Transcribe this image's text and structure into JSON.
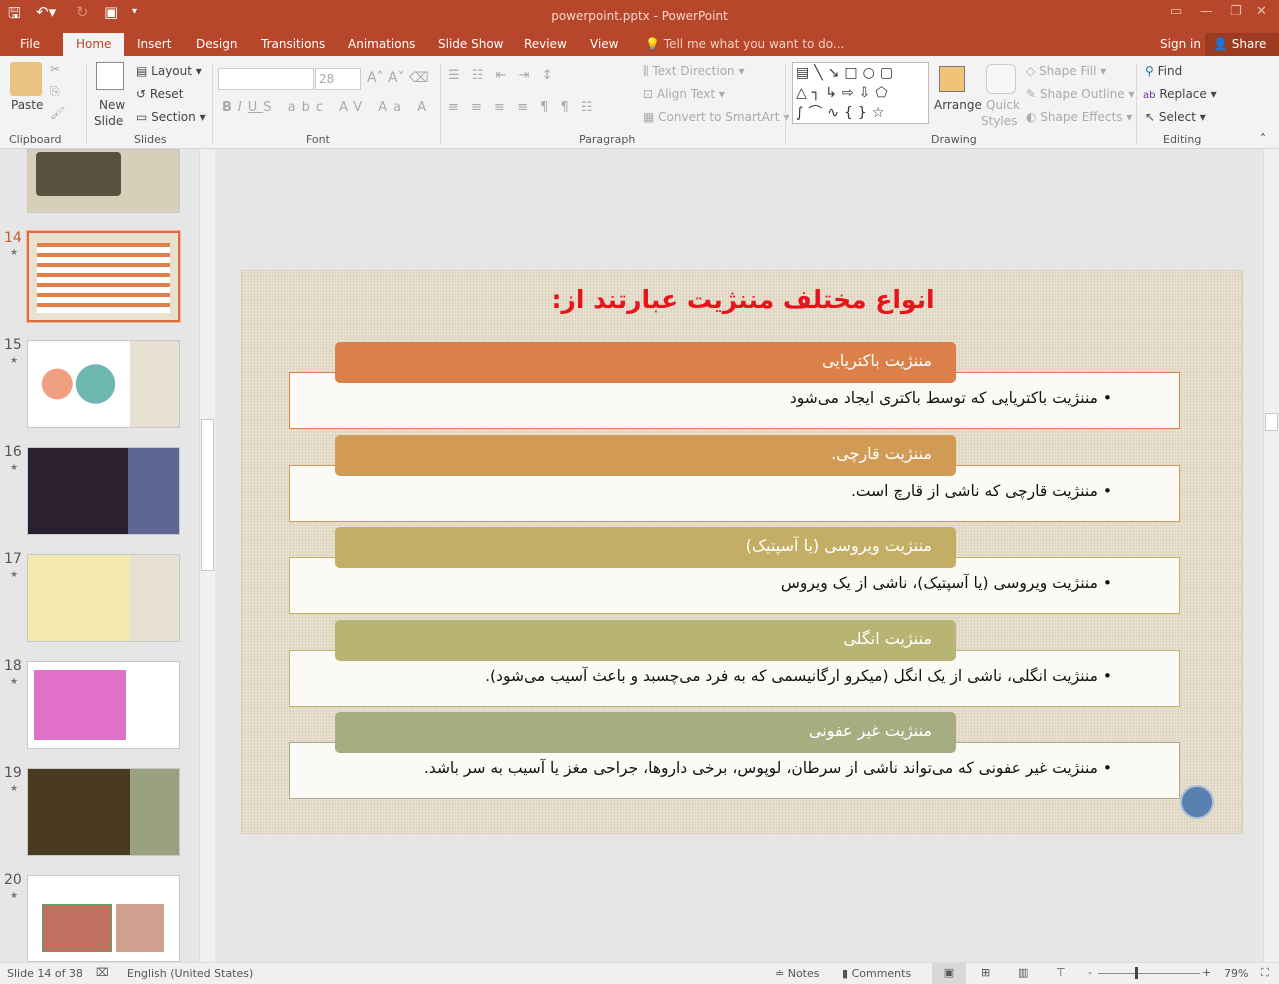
{
  "window": {
    "title": "powerpoint.pptx - PowerPoint"
  },
  "tabs": [
    "File",
    "Home",
    "Insert",
    "Design",
    "Transitions",
    "Animations",
    "Slide Show",
    "Review",
    "View"
  ],
  "tell_me": "Tell me what you want to do...",
  "sign_in": "Sign in",
  "share": "Share",
  "ribbon": {
    "clipboard": {
      "paste": "Paste",
      "group": "Clipboard"
    },
    "slides": {
      "new_slide": "New",
      "new_slide2": "Slide",
      "layout": "Layout",
      "reset": "Reset",
      "section": "Section",
      "group": "Slides"
    },
    "font": {
      "font_name": "",
      "font_size": "28",
      "group": "Font"
    },
    "paragraph": {
      "text_direction": "Text Direction",
      "align_text": "Align Text",
      "convert": "Convert to SmartArt",
      "group": "Paragraph"
    },
    "drawing": {
      "arrange": "Arrange",
      "quick": "Quick",
      "styles": "Styles",
      "shape_fill": "Shape Fill",
      "shape_outline": "Shape Outline",
      "shape_effects": "Shape Effects",
      "group": "Drawing"
    },
    "editing": {
      "find": "Find",
      "replace": "Replace",
      "select": "Select",
      "group": "Editing"
    }
  },
  "thumbnails": [
    {
      "n": "14",
      "selected": true
    },
    {
      "n": "15"
    },
    {
      "n": "16"
    },
    {
      "n": "17"
    },
    {
      "n": "18"
    },
    {
      "n": "19"
    },
    {
      "n": "20"
    }
  ],
  "slide": {
    "title": "انواع مختلف مننژیت عبارتند از:",
    "items": [
      {
        "header": "مننژیت باکتریایی",
        "bullet": "مننژیت باکتریایی که توسط باکتری ایجاد می‌شود",
        "color": "#dc8049"
      },
      {
        "header": "مننژیت قارچی.",
        "bullet": "مننژیت قارچی که ناشی از قارچ است.",
        "color": "#d19b55"
      },
      {
        "header": "مننژیت ویروسی (یا آسپتیک)",
        "bullet": "مننژیت ویروسی (یا آسپتیک)، ناشی از یک ویروس",
        "color": "#c4ad65"
      },
      {
        "header": "مننژیت انگلی",
        "bullet": "مننژیت انگلی، ناشی از یک انگل (میکرو ارگانیسمی که به فرد می‌چسبد و باعث آسیب می‌شود).",
        "color": "#b8b474"
      },
      {
        "header": "مننژیت غیر عفونی",
        "bullet": "مننژیت غیر عفونی که می‌تواند ناشی از سرطان، لوپوس، برخی داروها، جراحی مغز یا آسیب به سر باشد.",
        "color": "#a6ad81"
      }
    ]
  },
  "status": {
    "slide": "Slide 14 of 38",
    "language": "English (United States)",
    "notes": "Notes",
    "comments": "Comments",
    "zoom": "79%"
  },
  "accent": "#b7472a"
}
